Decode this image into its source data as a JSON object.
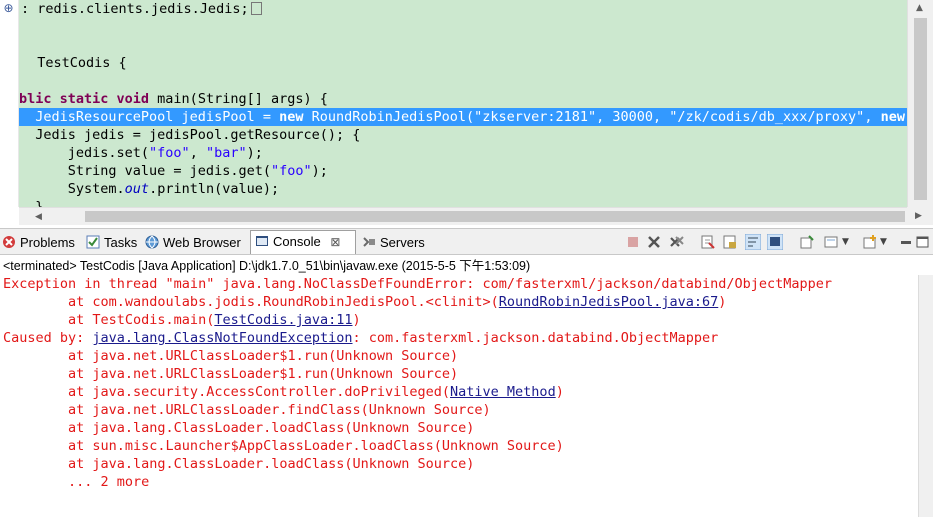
{
  "editor": {
    "lines": [
      {
        "parts": [
          {
            "t": ": redis.clients.jedis.Jedis;",
            "c": ""
          }
        ],
        "fold": true
      },
      {
        "parts": [
          {
            "t": "",
            "c": ""
          }
        ]
      },
      {
        "parts": [
          {
            "t": "",
            "c": ""
          }
        ]
      },
      {
        "parts": [
          {
            "t": "  TestCodis {",
            "c": ""
          }
        ]
      },
      {
        "parts": [
          {
            "t": "",
            "c": ""
          }
        ]
      },
      {
        "parts": [
          {
            "t": "blic static void",
            "c": "kw"
          },
          {
            "t": " main(String[] args) {",
            "c": ""
          }
        ]
      },
      {
        "parts": [
          {
            "t": "  JedisResourcePool jedisPool = ",
            "c": ""
          },
          {
            "t": "new",
            "c": "kw"
          },
          {
            "t": " RoundRobinJedisPool(",
            "c": ""
          },
          {
            "t": "\"zkserver:2181\"",
            "c": "str"
          },
          {
            "t": ", 30000, ",
            "c": ""
          },
          {
            "t": "\"/zk/codis/db_xxx/proxy\"",
            "c": "str"
          },
          {
            "t": ", ",
            "c": ""
          },
          {
            "t": "new",
            "c": "kw"
          }
        ],
        "selected": true
      },
      {
        "parts": [
          {
            "t": "  Jedis jedis = jedisPool.getResource(); {",
            "c": ""
          }
        ]
      },
      {
        "parts": [
          {
            "t": "      jedis.set(",
            "c": ""
          },
          {
            "t": "\"foo\"",
            "c": "str"
          },
          {
            "t": ", ",
            "c": ""
          },
          {
            "t": "\"bar\"",
            "c": "str"
          },
          {
            "t": ");",
            "c": ""
          }
        ]
      },
      {
        "parts": [
          {
            "t": "      String value = jedis.get(",
            "c": ""
          },
          {
            "t": "\"foo\"",
            "c": "str"
          },
          {
            "t": ");",
            "c": ""
          }
        ]
      },
      {
        "parts": [
          {
            "t": "      System.",
            "c": ""
          },
          {
            "t": "out",
            "c": "it"
          },
          {
            "t": ".println(value);",
            "c": ""
          }
        ]
      },
      {
        "parts": [
          {
            "t": "  }",
            "c": ""
          }
        ]
      }
    ]
  },
  "views": {
    "tabs": [
      {
        "label": "Problems",
        "icon": "problems-icon"
      },
      {
        "label": "Tasks",
        "icon": "tasks-icon"
      },
      {
        "label": "Web Browser",
        "icon": "globe-icon"
      },
      {
        "label": "Console",
        "icon": "console-icon",
        "active": true,
        "close": "⊠"
      },
      {
        "label": "Servers",
        "icon": "servers-icon"
      }
    ]
  },
  "console": {
    "title": "<terminated> TestCodis [Java Application] D:\\jdk1.7.0_51\\bin\\javaw.exe (2015-5-5 下午1:53:09)",
    "lines": [
      [
        {
          "t": "Exception in thread \"main\" java.lang.NoClassDefFoundError: com/fasterxml/jackson/databind/ObjectMapper",
          "c": ""
        }
      ],
      [
        {
          "t": "        at com.wandoulabs.jodis.RoundRobinJedisPool.<clinit>(",
          "c": ""
        },
        {
          "t": "RoundRobinJedisPool.java:67",
          "c": "lnk"
        },
        {
          "t": ")",
          "c": ""
        }
      ],
      [
        {
          "t": "        at TestCodis.main(",
          "c": ""
        },
        {
          "t": "TestCodis.java:11",
          "c": "lnk"
        },
        {
          "t": ")",
          "c": ""
        }
      ],
      [
        {
          "t": "Caused by: ",
          "c": ""
        },
        {
          "t": "java.lang.ClassNotFoundException",
          "c": "lnk"
        },
        {
          "t": ": com.fasterxml.jackson.databind.ObjectMapper",
          "c": ""
        }
      ],
      [
        {
          "t": "        at java.net.URLClassLoader$1.run(Unknown Source)",
          "c": ""
        }
      ],
      [
        {
          "t": "        at java.net.URLClassLoader$1.run(Unknown Source)",
          "c": ""
        }
      ],
      [
        {
          "t": "        at java.security.AccessController.doPrivileged(",
          "c": ""
        },
        {
          "t": "Native Method",
          "c": "lnk"
        },
        {
          "t": ")",
          "c": ""
        }
      ],
      [
        {
          "t": "        at java.net.URLClassLoader.findClass(Unknown Source)",
          "c": ""
        }
      ],
      [
        {
          "t": "        at java.lang.ClassLoader.loadClass(Unknown Source)",
          "c": ""
        }
      ],
      [
        {
          "t": "        at sun.misc.Launcher$AppClassLoader.loadClass(Unknown Source)",
          "c": ""
        }
      ],
      [
        {
          "t": "        at java.lang.ClassLoader.loadClass(Unknown Source)",
          "c": ""
        }
      ],
      [
        {
          "t": "        ... 2 more",
          "c": ""
        }
      ]
    ]
  },
  "colors": {
    "editor_bg": "#cce8cf",
    "selection": "#3399ff",
    "keyword": "#7f0055",
    "string": "#2a00ff",
    "error": "#e21818",
    "link": "#1a1a8c"
  }
}
